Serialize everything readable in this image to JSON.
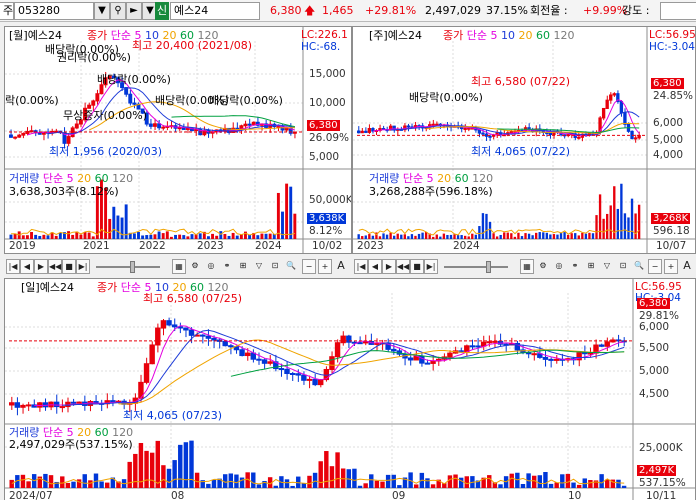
{
  "topbar": {
    "mode_label": "주",
    "code": "053280",
    "dropdown_icon": "chevron-down-icon",
    "credit_badge": "신",
    "name": "예스24",
    "price": "6,380",
    "change": "1,465",
    "change_pct": "+29.81%",
    "volume": "2,497,029",
    "volume_pct": "37.15%",
    "turnover_label": "회전율 :",
    "turnover_value": "+9.99%",
    "strength_label": "강도 :"
  },
  "monthly": {
    "title": "[월]예스24",
    "legend": [
      "종가",
      "단순",
      "5",
      "10",
      "20",
      "60",
      "120"
    ],
    "lc": "LC:226.1",
    "hc": "HC:-68.",
    "price_tag": "6,380",
    "pct_tag": "26.09%",
    "y_ticks": [
      "15,000",
      "10,000",
      "5,000"
    ],
    "annotations": {
      "high": "최고 20,400 (2021/08)",
      "low": "최저 1,956 (2020/03)",
      "div1": "배당락(0.00%)",
      "div2": "배당락(0.00%)",
      "div3": "배당락(0.00%)",
      "div4": "배당락(0.00%)",
      "div5": "락(0.00%)",
      "div6": "무상증자(0.00%)",
      "div7": "권리락(0.00%)",
      "div8": "배당락(0.00%)"
    },
    "vol_title": "거래량",
    "vol_legend": [
      "단순",
      "5",
      "20",
      "60",
      "120"
    ],
    "vol_value": "3,638,303주(8.12%)",
    "vol_ticks": [
      "50,000K",
      "25,000K"
    ],
    "vol_tag": "3,638K",
    "vol_pct": "8.12%",
    "x_ticks": [
      "2019",
      "2021",
      "2022",
      "2023",
      "2024"
    ],
    "x_end": "10/02"
  },
  "weekly": {
    "title": "[주]예스24",
    "legend": [
      "종가",
      "단순",
      "5",
      "10",
      "20",
      "60",
      "120"
    ],
    "lc": "LC:56.95",
    "hc": "HC:-3.04",
    "price_tag": "6,380",
    "pct_tag": "24.85%",
    "y_ticks": [
      "6,000",
      "5,000",
      "4,000"
    ],
    "annotations": {
      "high": "최고 6,580 (07/22)",
      "low": "최저 4,065 (07/22)",
      "div": "배당락(0.00%)"
    },
    "vol_title": "거래량",
    "vol_legend": [
      "단순",
      "5",
      "20",
      "60",
      "120"
    ],
    "vol_value": "3,268,288주(596.18%)",
    "vol_tag": "3,268K",
    "vol_pct": "596.18",
    "x_ticks": [
      "2023",
      "2024"
    ],
    "x_end": "10/07"
  },
  "daily": {
    "title": "[일]예스24",
    "legend": [
      "종가",
      "단순",
      "5",
      "10",
      "20",
      "60",
      "120"
    ],
    "lc": "LC:56.95",
    "hc": "HC:-3.04",
    "price_tag": "6,380",
    "pct_tag": "29.81%",
    "y_ticks": [
      "6,000",
      "5,500",
      "5,000",
      "4,500"
    ],
    "annotations": {
      "high": "최고 6,580 (07/25)",
      "low": "최저 4,065 (07/23)"
    },
    "vol_title": "거래량",
    "vol_legend": [
      "단순",
      "5",
      "20",
      "60",
      "120"
    ],
    "vol_value": "2,497,029주(537.15%)",
    "vol_ticks": [
      "25,000K"
    ],
    "vol_tag": "2,497K",
    "vol_pct": "537.15%",
    "x_ticks": [
      "2024/07",
      "08",
      "09",
      "10"
    ],
    "x_end": "10/11"
  },
  "toolbar": {
    "icons": [
      "first-icon",
      "prev-icon",
      "next-icon",
      "stop-icon",
      "last-icon",
      "zoom-slider-icon",
      "grid-icon",
      "settings-icon",
      "overlay-icon",
      "crosshair-icon",
      "indicator-icon",
      "search-icon",
      "minus-icon",
      "plus-icon",
      "text-icon"
    ],
    "text_btn": "A"
  },
  "colors": {
    "up": "#e8000b",
    "down": "#0037d8",
    "ma5": "#e400e0",
    "ma10": "#1e3cd8",
    "ma20": "#f0a400",
    "ma60": "#00a040",
    "ma120": "#7a7a7a"
  }
}
